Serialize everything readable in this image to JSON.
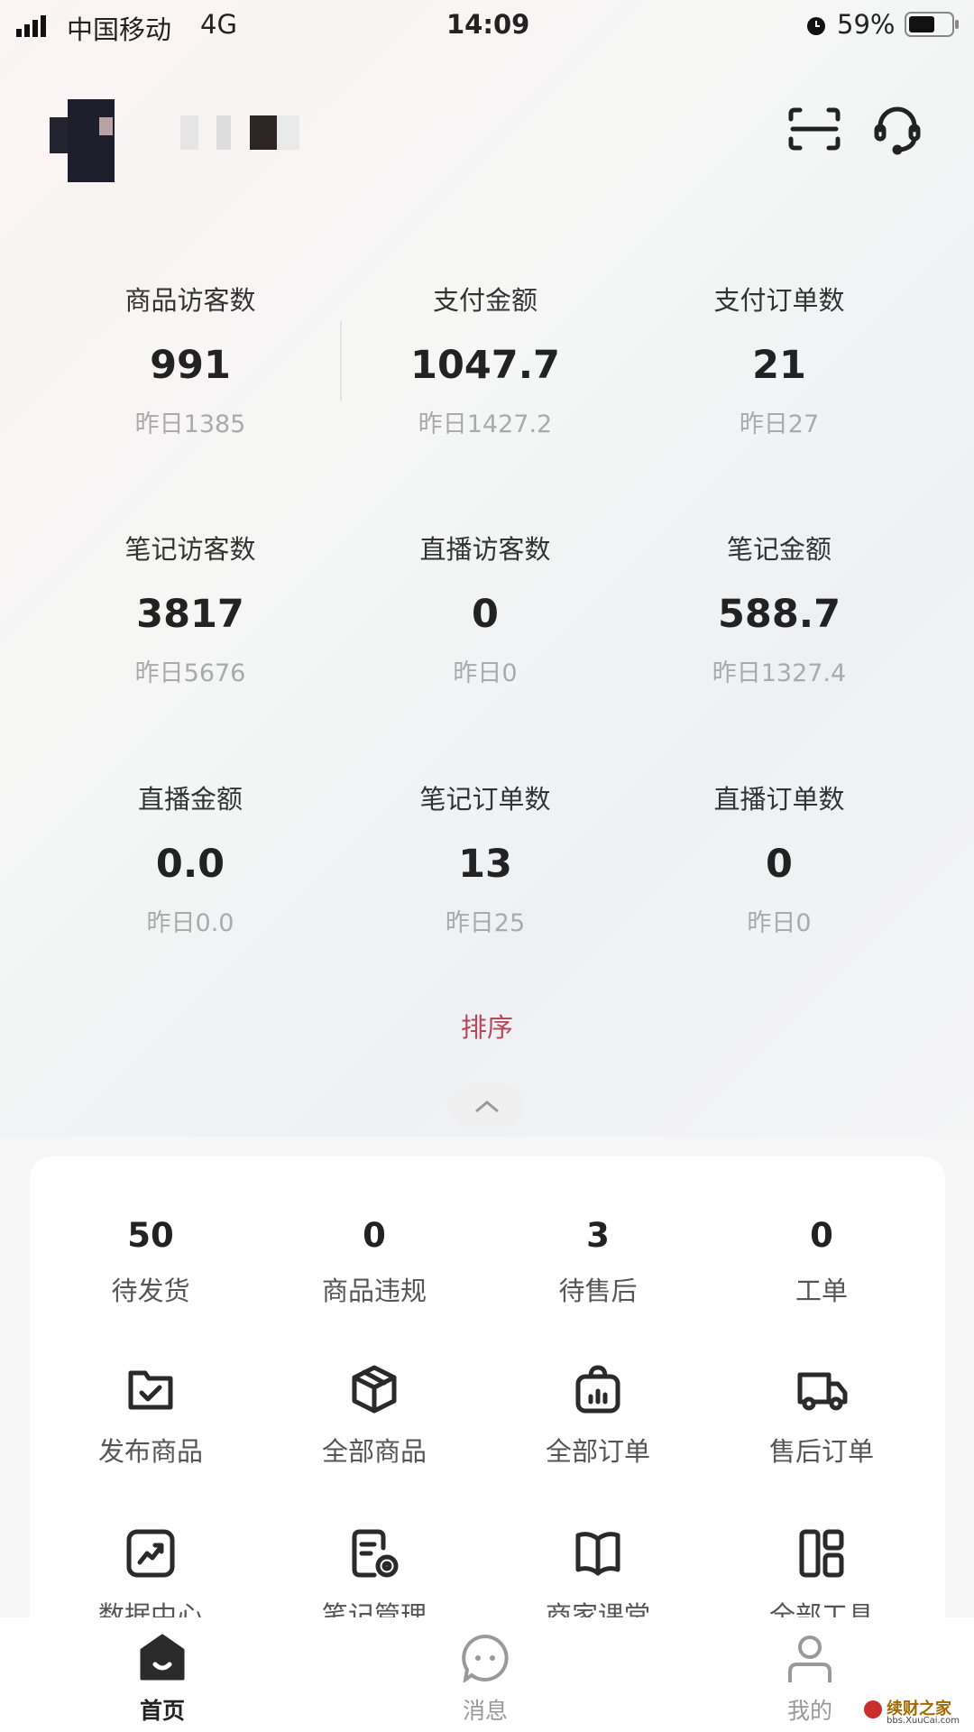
{
  "status_bar": {
    "carrier": "中国移动",
    "network": "4G",
    "time": "14:09",
    "battery": "59%"
  },
  "header": {
    "icons": [
      "scan-icon",
      "customer-service-icon"
    ]
  },
  "stats": [
    {
      "label": "商品访客数",
      "value": "991",
      "yesterday": "昨日1385"
    },
    {
      "label": "支付金额",
      "value": "1047.7",
      "yesterday": "昨日1427.2"
    },
    {
      "label": "支付订单数",
      "value": "21",
      "yesterday": "昨日27"
    },
    {
      "label": "笔记访客数",
      "value": "3817",
      "yesterday": "昨日5676"
    },
    {
      "label": "直播访客数",
      "value": "0",
      "yesterday": "昨日0"
    },
    {
      "label": "笔记金额",
      "value": "588.7",
      "yesterday": "昨日1327.4"
    },
    {
      "label": "直播金额",
      "value": "0.0",
      "yesterday": "昨日0.0"
    },
    {
      "label": "笔记订单数",
      "value": "13",
      "yesterday": "昨日25"
    },
    {
      "label": "直播订单数",
      "value": "0",
      "yesterday": "昨日0"
    }
  ],
  "sort_label": "排序",
  "accent_color": "#b5475a",
  "counts": [
    {
      "value": "50",
      "label": "待发货"
    },
    {
      "value": "0",
      "label": "商品违规"
    },
    {
      "value": "3",
      "label": "待售后"
    },
    {
      "value": "0",
      "label": "工单"
    }
  ],
  "tools": [
    {
      "label": "发布商品",
      "icon": "folder-check-icon"
    },
    {
      "label": "全部商品",
      "icon": "box-icon"
    },
    {
      "label": "全部订单",
      "icon": "order-bag-icon"
    },
    {
      "label": "售后订单",
      "icon": "truck-icon"
    },
    {
      "label": "数据中心",
      "icon": "trend-chart-icon"
    },
    {
      "label": "笔记管理",
      "icon": "note-settings-icon"
    },
    {
      "label": "商家课堂",
      "icon": "book-icon"
    },
    {
      "label": "全部工具",
      "icon": "tools-grid-icon"
    }
  ],
  "tabs": [
    {
      "label": "首页",
      "icon": "home-icon",
      "active": true
    },
    {
      "label": "消息",
      "icon": "message-icon",
      "active": false
    },
    {
      "label": "我的",
      "icon": "profile-icon",
      "active": false
    }
  ],
  "watermark": {
    "text": "续财之家",
    "sub": "bbs.XuuCai.com"
  }
}
